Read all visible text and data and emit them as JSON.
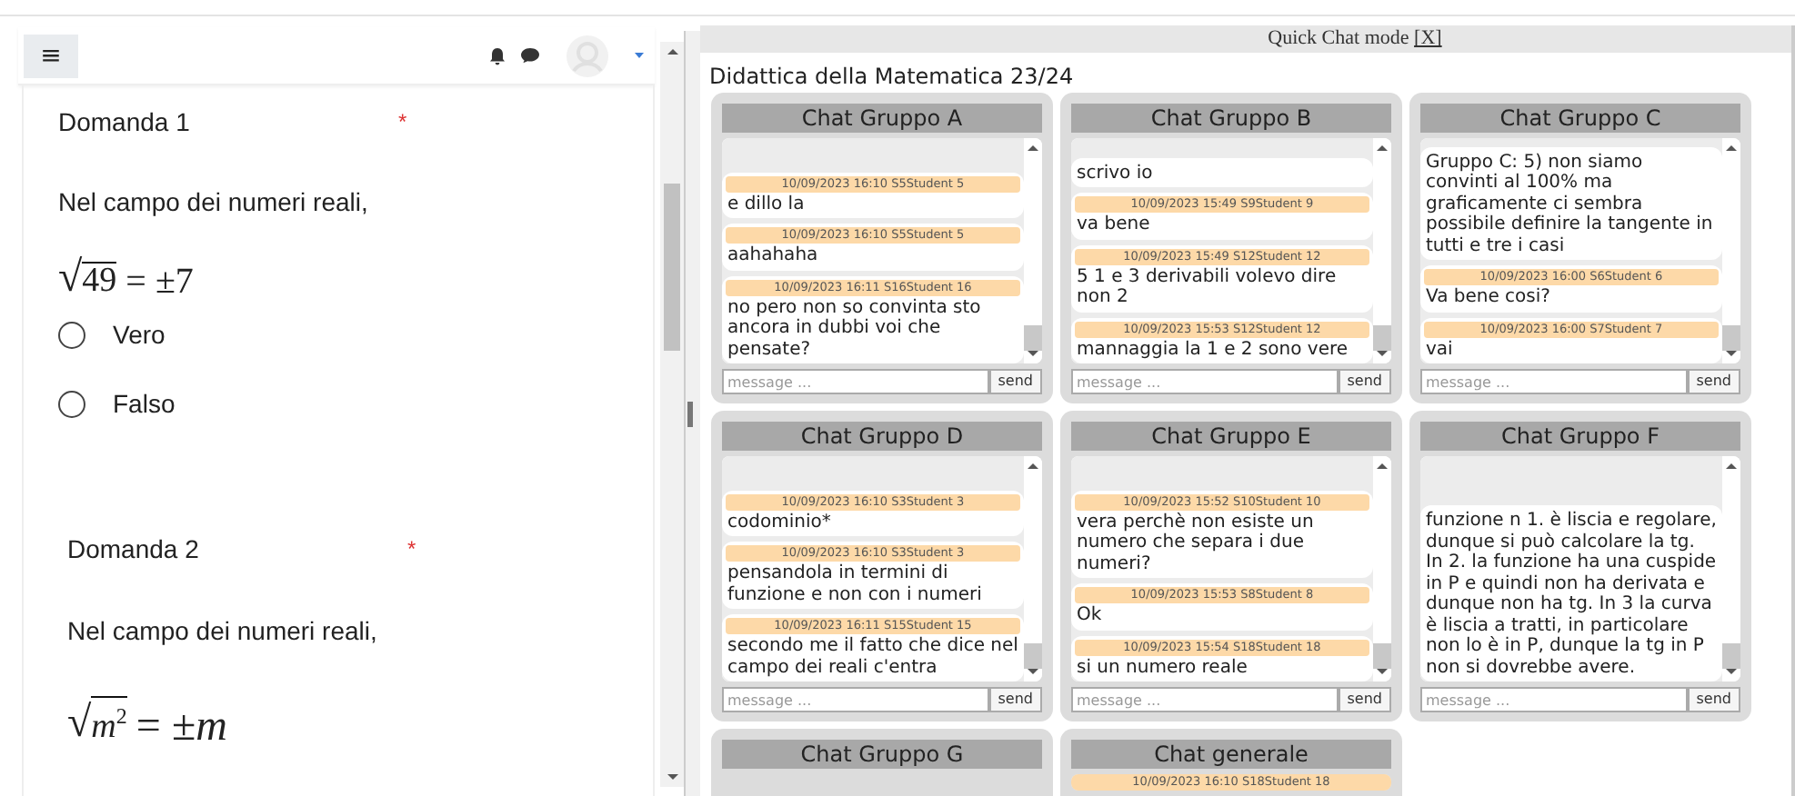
{
  "left_panel": {
    "menu_button": "≡",
    "questions": [
      {
        "title": "Domanda 1",
        "required_mark": "*",
        "text": "Nel campo dei numeri reali,",
        "formula": {
          "radical": "√",
          "radicand": "49",
          "rest": "= ±7"
        },
        "options": [
          {
            "label": "Vero",
            "selected": false
          },
          {
            "label": "Falso",
            "selected": false
          }
        ]
      },
      {
        "title": "Domanda 2",
        "required_mark": "*",
        "text": "Nel campo dei numeri reali,",
        "formula": {
          "radical": "√",
          "radicand": "*m*$^{2}$",
          "rest": "= ±*m*"
        }
      }
    ]
  },
  "quick_chat": {
    "label": "Quick Chat mode",
    "close": "[X]"
  },
  "course_title": "Didattica della Matematica 23/24",
  "chats": [
    {
      "title": "Chat Gruppo A",
      "placeholder": "message ...",
      "send": "send",
      "messages": [
        {
          "meta": "10/09/2023 16:10 S5Student 5",
          "text": "e dillo la"
        },
        {
          "meta": "10/09/2023 16:10 S5Student 5",
          "text": "aahahaha"
        },
        {
          "meta": "10/09/2023 16:11 S16Student 16",
          "text": "no pero non so convinta sto ancora in dubbi voi che pensate?"
        }
      ]
    },
    {
      "title": "Chat Gruppo B",
      "placeholder": "message ...",
      "send": "send",
      "messages": [
        {
          "text": "scrivo io"
        },
        {
          "meta": "10/09/2023 15:49 S9Student 9",
          "text": "va bene"
        },
        {
          "meta": "10/09/2023 15:49 S12Student 12",
          "text": "5 1 e 3 derivabili volevo dire non 2"
        },
        {
          "meta": "10/09/2023 15:53 S12Student 12",
          "text": "mannaggia la 1 e 2 sono vere"
        }
      ]
    },
    {
      "title": "Chat Gruppo C",
      "placeholder": "message ...",
      "send": "send",
      "messages": [
        {
          "text": "Gruppo C: 5) non siamo convinti al 100% ma graficamente ci sembra possibile definire la tangente in tutti e tre i casi"
        },
        {
          "meta": "10/09/2023 16:00 S6Student 6",
          "text": "Va bene cosi?"
        },
        {
          "meta": "10/09/2023 16:00 S7Student 7",
          "text": "vai"
        }
      ]
    },
    {
      "title": "Chat Gruppo D",
      "placeholder": "message ...",
      "send": "send",
      "messages": [
        {
          "meta": "10/09/2023 16:10 S3Student 3",
          "text": "codominio*"
        },
        {
          "meta": "10/09/2023 16:10 S3Student 3",
          "text": "pensandola in termini di funzione e non con i numeri"
        },
        {
          "meta": "10/09/2023 16:11 S15Student 15",
          "text": "secondo me il fatto che dice nel campo dei reali c'entra"
        }
      ]
    },
    {
      "title": "Chat Gruppo E",
      "placeholder": "message ...",
      "send": "send",
      "messages": [
        {
          "meta": "10/09/2023 15:52 S10Student 10",
          "text": "vera perchè non esiste un numero che separa i due numeri?"
        },
        {
          "meta": "10/09/2023 15:53 S8Student 8",
          "text": "Ok"
        },
        {
          "meta": "10/09/2023 15:54 S18Student 18",
          "text": "si un numero reale"
        }
      ]
    },
    {
      "title": "Chat Gruppo F",
      "placeholder": "message ...",
      "send": "send",
      "messages": [
        {
          "text": "funzione n 1. è liscia e regolare, dunque si può calcolare la tg. In 2. la funzione ha una cuspide in P e quindi non ha derivata e dunque non ha tg. In 3 la curva è liscia a tratti, in particolare non lo è in P, dunque la tg in P non si dovrebbe avere."
        }
      ]
    },
    {
      "title": "Chat Gruppo G"
    },
    {
      "title": "Chat generale",
      "messages": [
        {
          "meta": "10/09/2023 16:10 S18Student 18"
        }
      ]
    }
  ]
}
